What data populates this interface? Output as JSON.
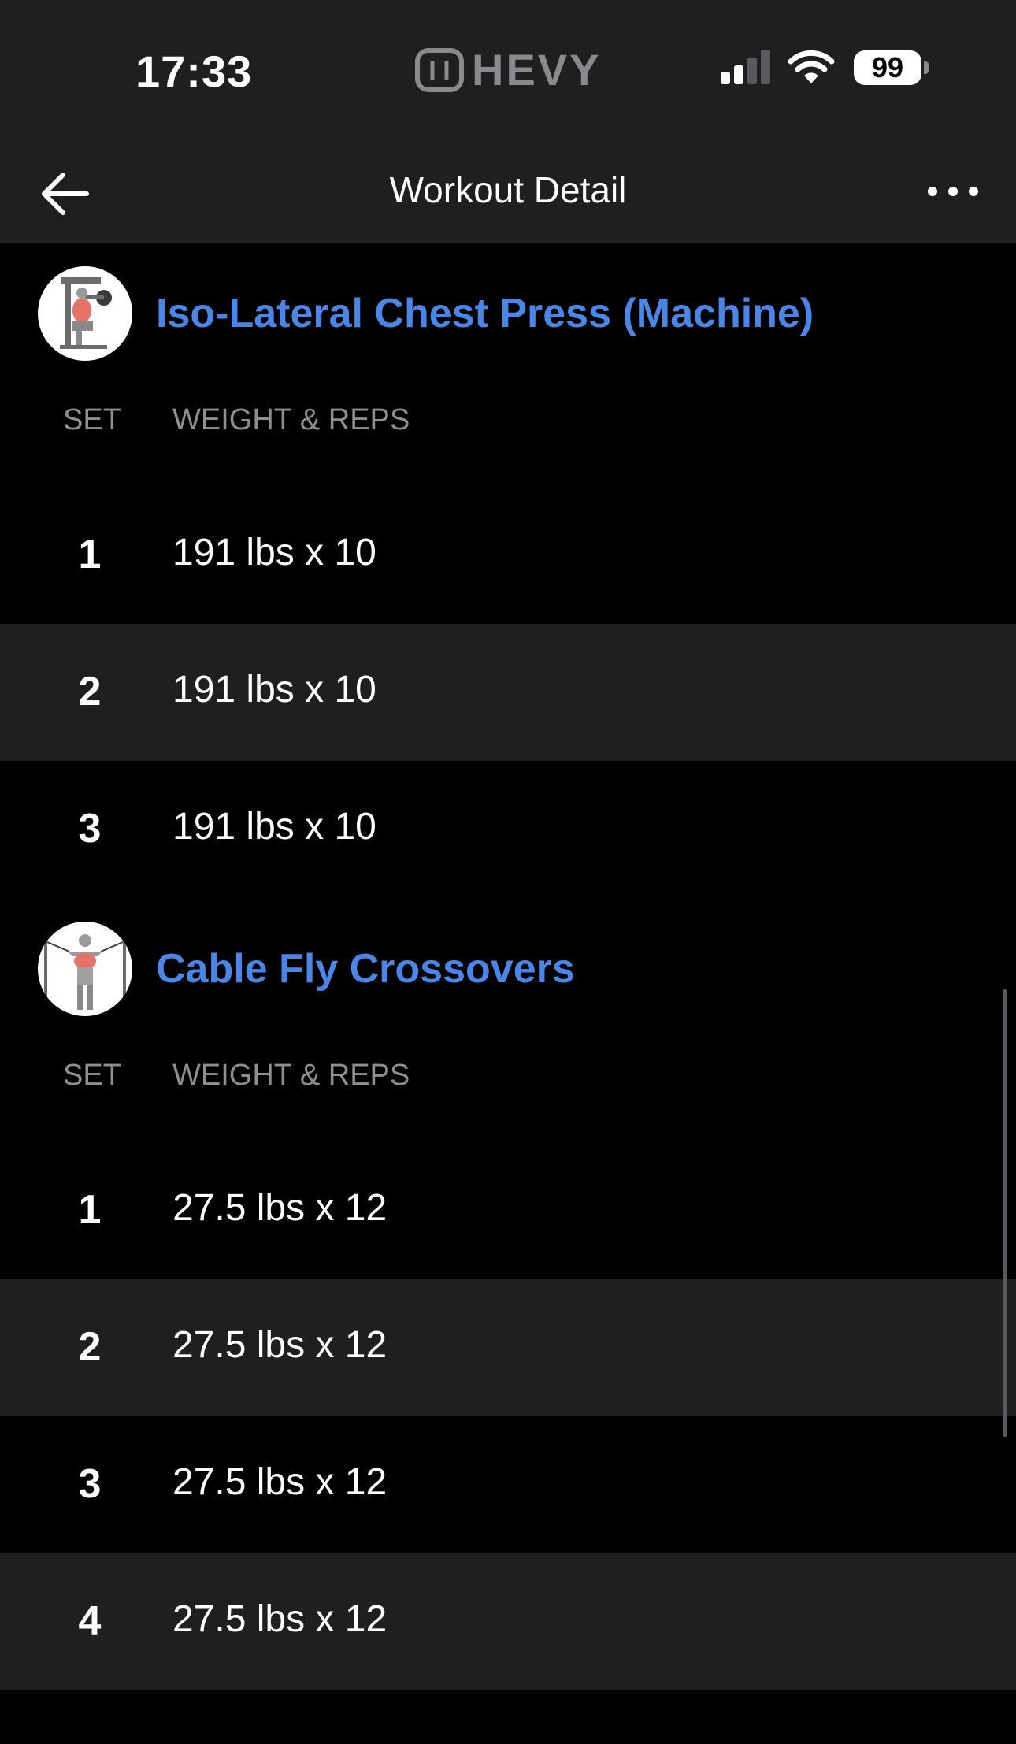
{
  "status_bar": {
    "time": "17:33",
    "brand": "HEVY",
    "battery": "99",
    "icons": [
      "signal-icon",
      "wifi-icon",
      "battery-icon"
    ]
  },
  "nav": {
    "title": "Workout Detail",
    "back_icon": "arrow-left-icon",
    "more_icon": "ellipsis-icon"
  },
  "columns": {
    "set": "SET",
    "weight_reps": "WEIGHT & REPS"
  },
  "exercises": [
    {
      "name": "Iso-Lateral Chest Press (Machine)",
      "sets": [
        {
          "set": "1",
          "value": "191 lbs x 10"
        },
        {
          "set": "2",
          "value": "191 lbs x 10"
        },
        {
          "set": "3",
          "value": "191 lbs x 10"
        }
      ]
    },
    {
      "name": "Cable Fly Crossovers",
      "sets": [
        {
          "set": "1",
          "value": "27.5 lbs x 12"
        },
        {
          "set": "2",
          "value": "27.5 lbs x 12"
        },
        {
          "set": "3",
          "value": "27.5 lbs x 12"
        },
        {
          "set": "4",
          "value": "27.5 lbs x 12"
        }
      ]
    }
  ],
  "colors": {
    "accent": "#4a86e8",
    "bar_bg": "#1f1f21",
    "alt_row": "#1f1f21",
    "muted": "#8e8e93"
  }
}
